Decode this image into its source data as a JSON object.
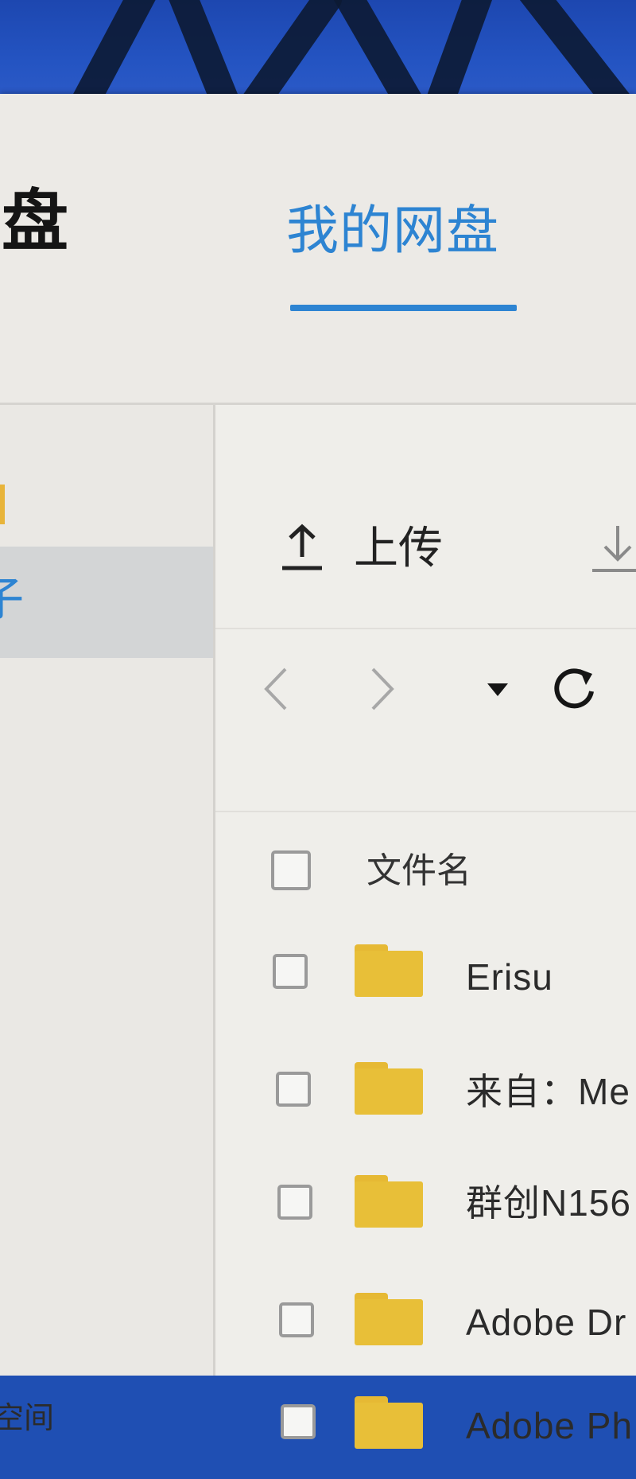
{
  "app": {
    "title_partial": "盘"
  },
  "header": {
    "tabs": [
      {
        "label": "我的网盘",
        "active": true
      }
    ],
    "accent_color": "#2d84d2"
  },
  "sidebar": {
    "highlighted_item_partial": "子",
    "storage_label_partial": "空间"
  },
  "toolbar": {
    "upload_label": "上传",
    "upload_icon": "upload-icon",
    "download_icon": "download-icon"
  },
  "navigation": {
    "back_icon": "chevron-left-icon",
    "forward_icon": "chevron-right-icon",
    "dropdown_icon": "caret-down-icon",
    "refresh_icon": "refresh-icon"
  },
  "file_list": {
    "column_filename": "文件名",
    "rows": [
      {
        "name": "Erisu",
        "type": "folder"
      },
      {
        "name": "来自：Me",
        "type": "folder"
      },
      {
        "name": "群创N156",
        "type": "folder"
      },
      {
        "name": "Adobe Dr",
        "type": "folder"
      },
      {
        "name": "Adobe Ph",
        "type": "folder"
      }
    ],
    "folder_color": "#e8bf38"
  }
}
